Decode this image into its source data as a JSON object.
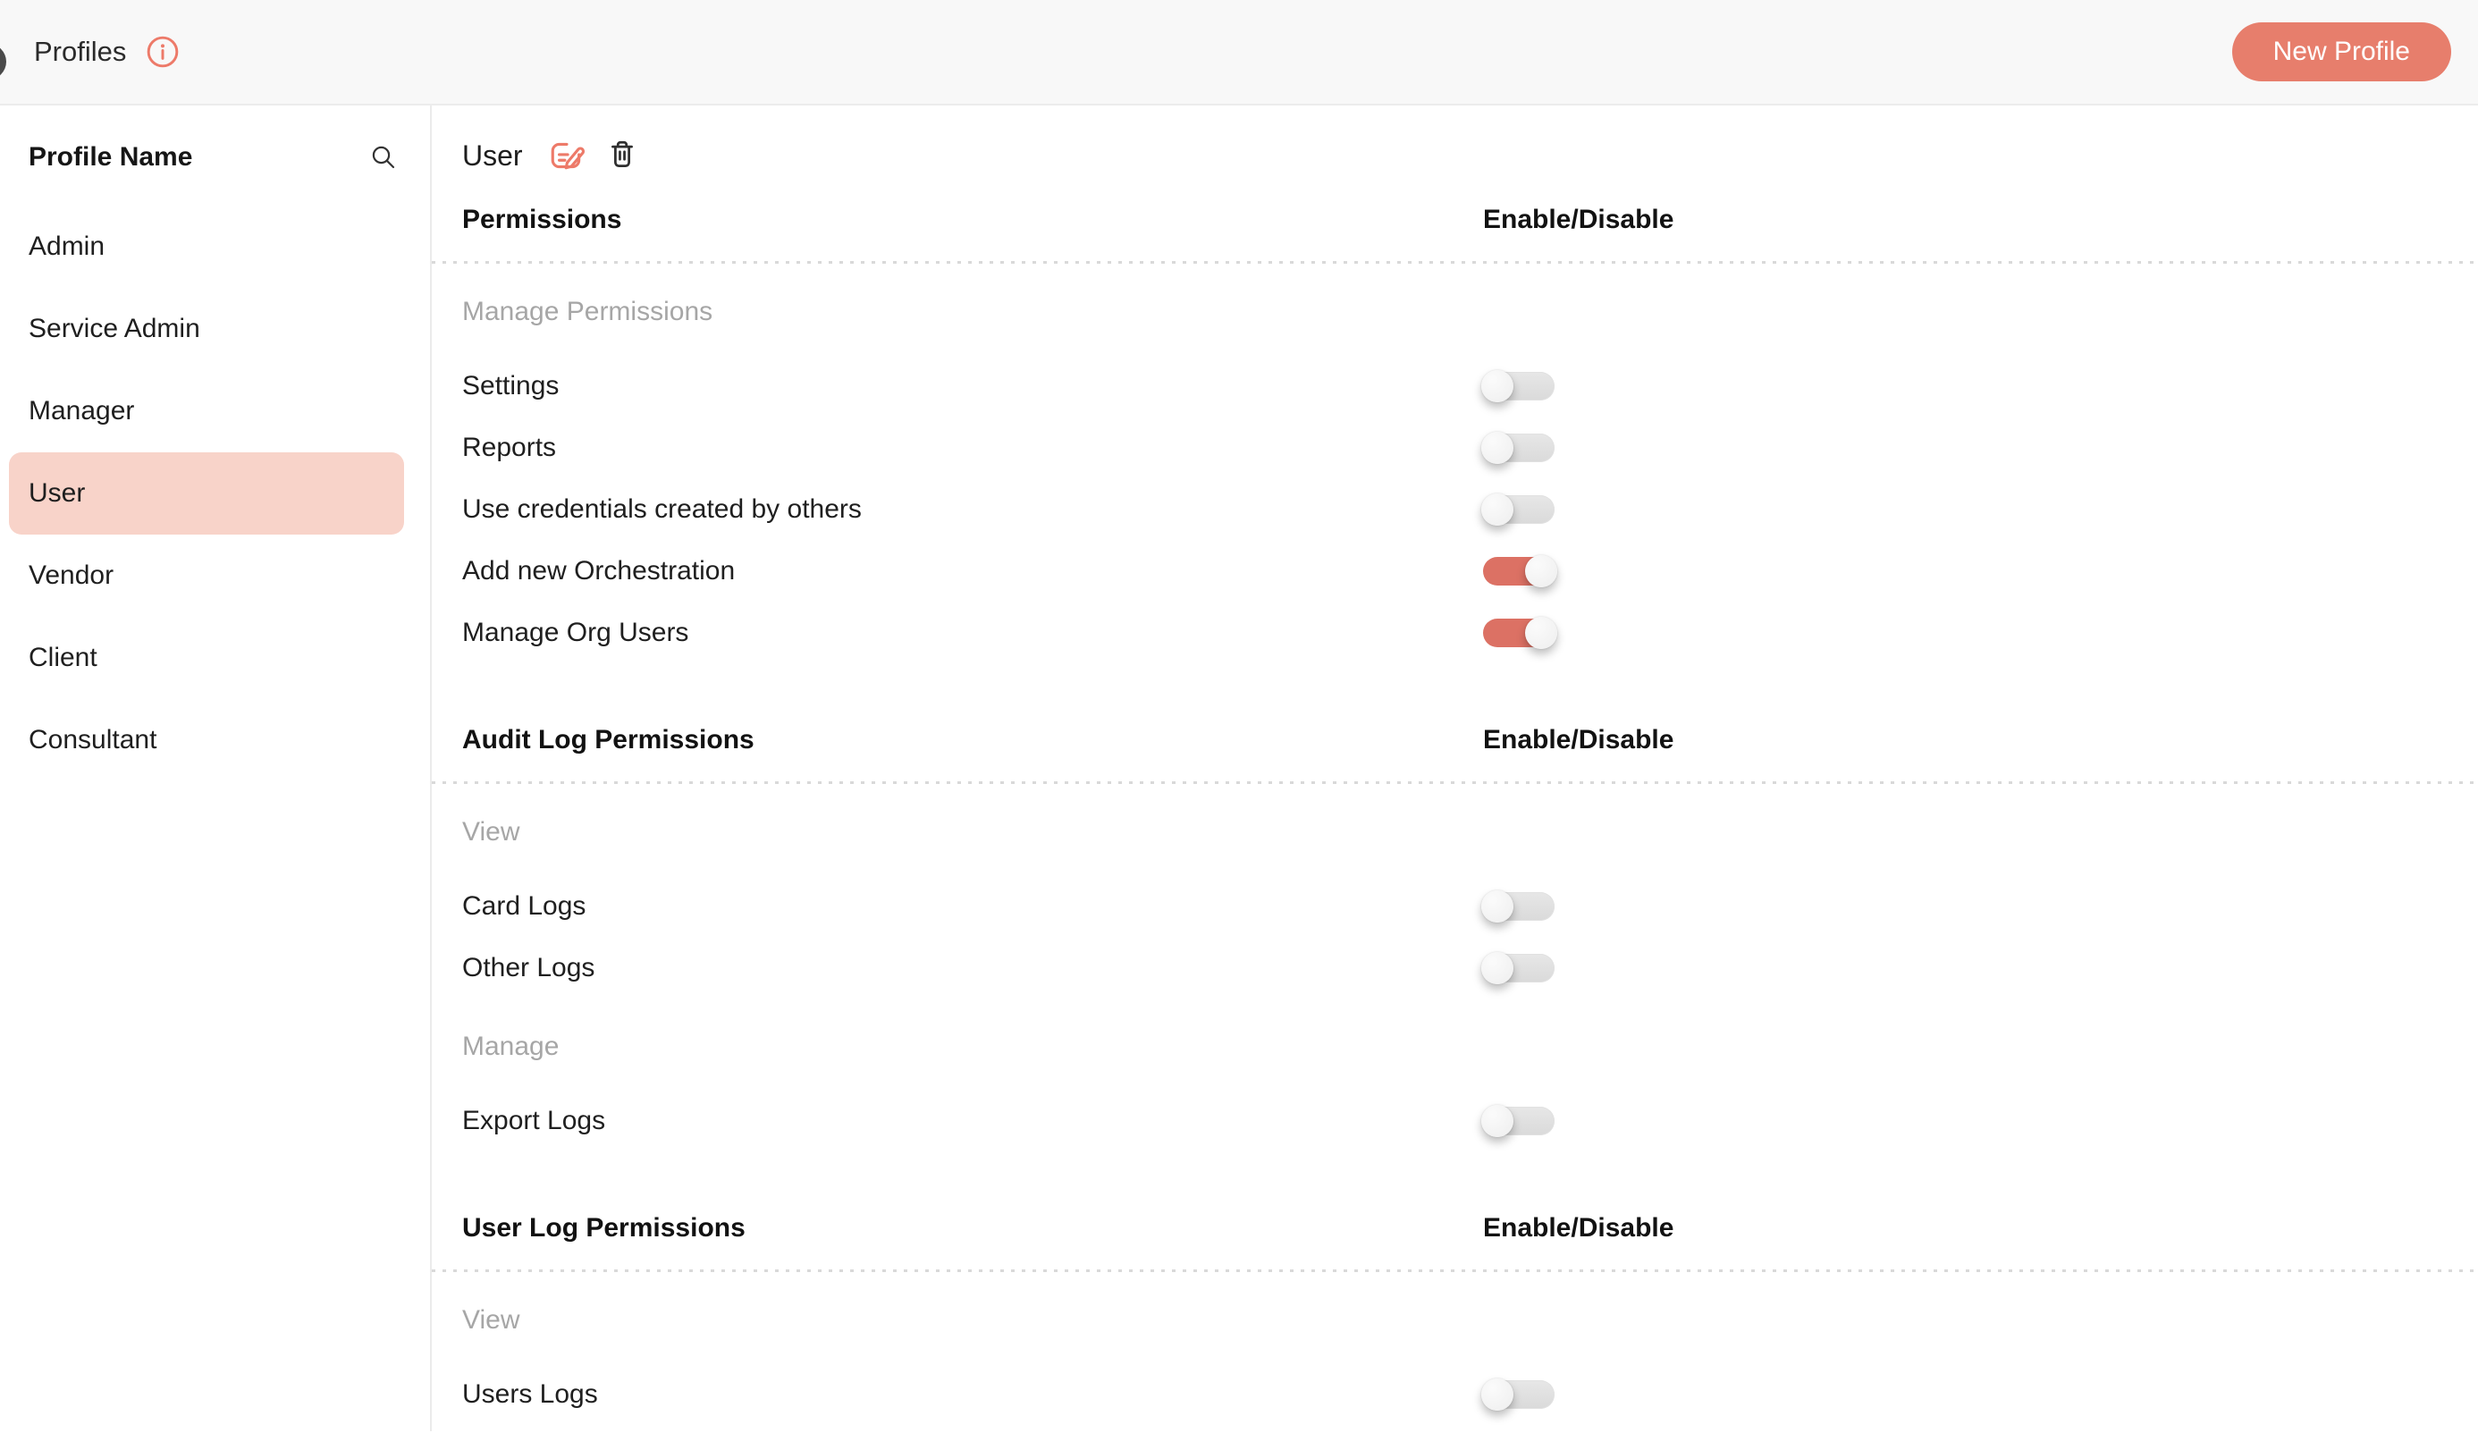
{
  "header": {
    "title": "Profiles",
    "new_profile_label": "New Profile"
  },
  "sidebar": {
    "header": "Profile Name",
    "items": [
      {
        "label": "Admin",
        "selected": false
      },
      {
        "label": "Service Admin",
        "selected": false
      },
      {
        "label": "Manager",
        "selected": false
      },
      {
        "label": "User",
        "selected": true
      },
      {
        "label": "Vendor",
        "selected": false
      },
      {
        "label": "Client",
        "selected": false
      },
      {
        "label": "Consultant",
        "selected": false
      }
    ]
  },
  "main": {
    "profile_title": "User",
    "sections": [
      {
        "header": "Permissions",
        "toggle_col_header": "Enable/Disable",
        "groups": [
          {
            "label": "Manage Permissions",
            "rows": [
              {
                "label": "Settings",
                "enabled": false
              },
              {
                "label": "Reports",
                "enabled": false
              },
              {
                "label": "Use credentials created by others",
                "enabled": false
              },
              {
                "label": "Add new Orchestration",
                "enabled": true
              },
              {
                "label": "Manage Org Users",
                "enabled": true
              }
            ]
          }
        ]
      },
      {
        "header": "Audit Log Permissions",
        "toggle_col_header": "Enable/Disable",
        "groups": [
          {
            "label": "View",
            "rows": [
              {
                "label": "Card Logs",
                "enabled": false
              },
              {
                "label": "Other Logs",
                "enabled": false
              }
            ]
          },
          {
            "label": "Manage",
            "rows": [
              {
                "label": "Export Logs",
                "enabled": false
              }
            ]
          }
        ]
      },
      {
        "header": "User Log Permissions",
        "toggle_col_header": "Enable/Disable",
        "groups": [
          {
            "label": "View",
            "rows": [
              {
                "label": "Users Logs",
                "enabled": false
              }
            ]
          }
        ]
      }
    ]
  },
  "icons": {
    "info": "info-icon",
    "search": "search-icon",
    "edit": "edit-note-icon",
    "delete": "trash-icon"
  },
  "colors": {
    "accent": "#e77e6c",
    "toggle_on": "#dc7164",
    "selected_item_bg": "#f8d3c9",
    "group_label": "#a6a6a6",
    "topbar_bg": "#f8f8f8"
  }
}
